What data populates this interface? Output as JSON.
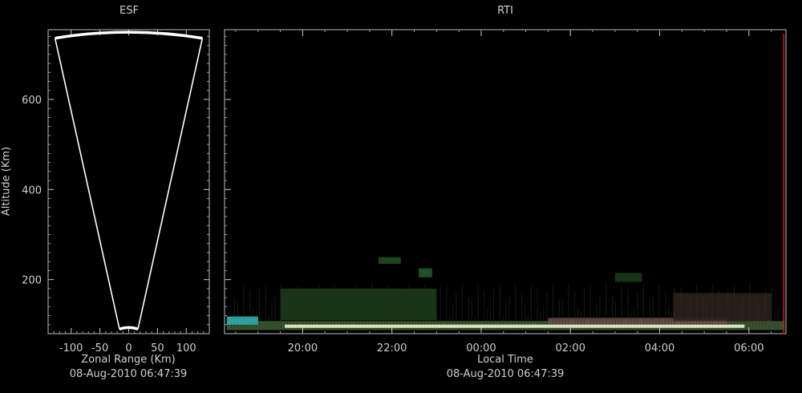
{
  "chart_data": [
    {
      "type": "sector",
      "title": "ESF",
      "xlabel": "Zonal Range (Km)",
      "ylabel": "Altitude (Km)",
      "timestamp": "08-Aug-2010 06:47:39",
      "xlim": [
        -140,
        140
      ],
      "ylim": [
        80,
        755
      ],
      "xticks": [
        "-100",
        "-50",
        "0",
        "50",
        "100"
      ],
      "xtick_values": [
        -100,
        -50,
        0,
        50,
        100
      ],
      "yticks": [
        "200",
        "400",
        "600"
      ],
      "ytick_values": [
        200,
        400,
        600
      ],
      "sector": {
        "inner_altitude": 90,
        "outer_altitude": 745,
        "half_width_at_outer": 128,
        "half_width_at_inner": 16
      },
      "line_color": "#ffffff"
    },
    {
      "type": "heatmap",
      "title": "RTI",
      "xlabel": "Local Time",
      "timestamp": "08-Aug-2010 06:47:39",
      "ylim": [
        80,
        755
      ],
      "x_range_hours": [
        18.25,
        30.83
      ],
      "xticks": [
        "20:00",
        "22:00",
        "00:00",
        "02:00",
        "04:00",
        "06:00"
      ],
      "xtick_values": [
        20,
        22,
        24,
        26,
        28,
        30
      ],
      "yticks": [
        "200",
        "400",
        "600"
      ],
      "ytick_values": [
        200,
        400,
        600
      ],
      "current_time_hours": 30.78,
      "current_time_color": "#c81e1e",
      "echo_layers": [
        {
          "t0": 18.3,
          "t1": 30.8,
          "alt0": 88,
          "alt1": 108,
          "color": "#3c5a32"
        },
        {
          "t0": 19.6,
          "t1": 29.9,
          "alt0": 93,
          "alt1": 100,
          "color": "#dcdcb4"
        },
        {
          "t0": 18.3,
          "t1": 19.0,
          "alt0": 100,
          "alt1": 118,
          "color": "#2ea5a0"
        },
        {
          "t0": 19.5,
          "t1": 23.0,
          "alt0": 110,
          "alt1": 180,
          "color": "#1c3a1a"
        },
        {
          "t0": 25.5,
          "t1": 29.5,
          "alt0": 100,
          "alt1": 115,
          "color": "#6a5048"
        },
        {
          "t0": 28.3,
          "t1": 30.5,
          "alt0": 108,
          "alt1": 170,
          "color": "#2a201a"
        },
        {
          "t0": 21.7,
          "t1": 22.2,
          "alt0": 235,
          "alt1": 250,
          "color": "#1f4a1f"
        },
        {
          "t0": 22.6,
          "t1": 22.9,
          "alt0": 205,
          "alt1": 225,
          "color": "#1f5a2a"
        },
        {
          "t0": 27.0,
          "t1": 27.6,
          "alt0": 195,
          "alt1": 215,
          "color": "#1a3a1a"
        }
      ]
    }
  ]
}
